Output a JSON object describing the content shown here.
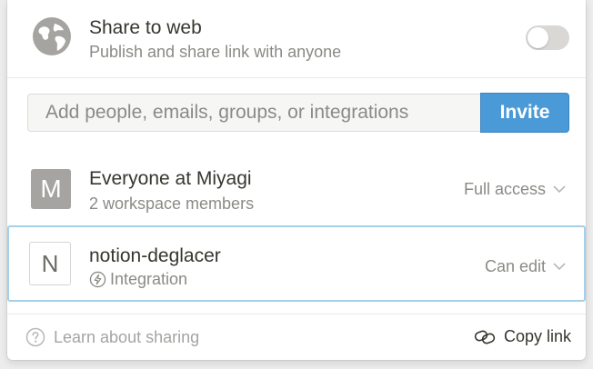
{
  "share_web": {
    "title": "Share to web",
    "subtitle": "Publish and share link with anyone",
    "toggle_on": false,
    "icon": "globe-icon"
  },
  "invite": {
    "placeholder": "Add people, emails, groups, or integrations",
    "button_label": "Invite"
  },
  "members": [
    {
      "avatar_letter": "M",
      "name": "Everyone at Miyagi",
      "detail": "2 workspace members",
      "access": "Full access"
    },
    {
      "avatar_letter": "N",
      "name": "notion-deglacer",
      "detail": "Integration",
      "detail_icon": "bolt-icon",
      "access": "Can edit"
    }
  ],
  "footer": {
    "learn_label": "Learn about sharing",
    "copy_label": "Copy link"
  },
  "colors": {
    "accent": "#4a9ad8",
    "selected_border": "#a6cfe9",
    "muted_text": "#8b8a86"
  }
}
